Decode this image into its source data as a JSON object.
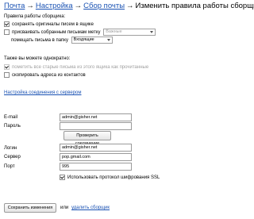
{
  "breadcrumb": {
    "items": [
      "Почта",
      "Настройка",
      "Сбор почты"
    ],
    "current": "Изменить правила работы сборщика",
    "separator": "→"
  },
  "rules": {
    "heading": "Правила работы сборщика:",
    "keep_originals": "сохранять оригиналы писем в ящике",
    "assign_label": "присваивать собранным письмам метку",
    "label_select": "Важные",
    "put_in_folder": "помещать письма в папку",
    "folder_select": "Входящие"
  },
  "also": {
    "heading": "Также вы можете однократно:",
    "mark_read": "пометить все старые письма из этого ящика как прочитанные",
    "copy_contacts": "скопировать адреса из контактов"
  },
  "connection": {
    "link": "Настройка соединения с сервером",
    "email_label": "E-mail",
    "email_value": "admin@gisher.net",
    "password_label": "Пароль",
    "password_value": "",
    "check_button": "Проверить соединение",
    "login_label": "Логин",
    "login_value": "admin@gisher.net",
    "server_label": "Сервер",
    "server_value": "pop.gmail.com",
    "port_label": "Порт",
    "port_value": "995",
    "ssl_label": "Использовать протокол шифрования SSL"
  },
  "footer": {
    "save_button": "Сохранить изменения",
    "or": "или",
    "delete_link": "удалить сборщик"
  },
  "colors": {
    "link": "#1a52b3"
  }
}
